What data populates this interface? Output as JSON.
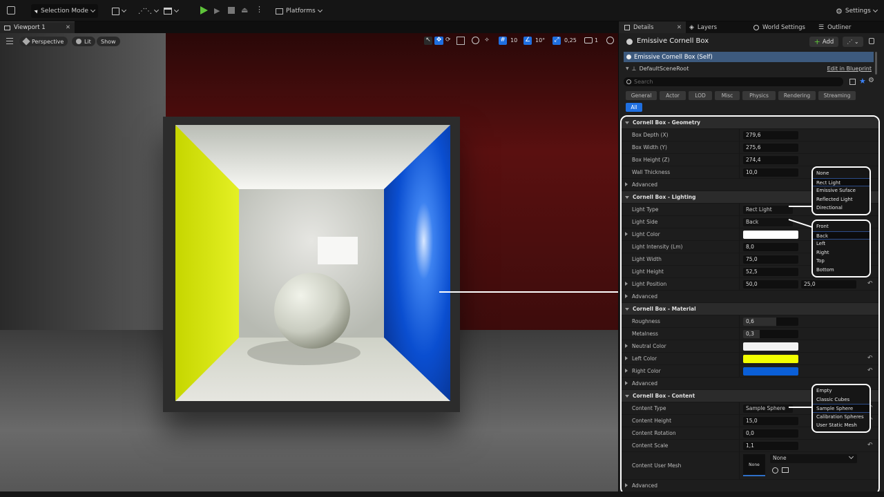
{
  "toolbar": {
    "mode_label": "Selection Mode",
    "platforms_label": "Platforms",
    "settings_label": "Settings"
  },
  "viewport": {
    "tab_label": "Viewport 1",
    "perspective_label": "Perspective",
    "lit_label": "Lit",
    "show_label": "Show",
    "grid_snap": "10",
    "rot_snap": "10°",
    "scale_snap": "0,25",
    "cam_speed": "1"
  },
  "details": {
    "tabs": {
      "details": "Details",
      "layers": "Layers",
      "world": "World Settings",
      "outliner": "Outliner"
    },
    "actor_name": "Emissive Cornell Box",
    "add_label": "Add",
    "self_item": "Emissive Cornell Box (Self)",
    "root_item": "DefaultSceneRoot",
    "edit_blueprint": "Edit in Blueprint",
    "search_placeholder": "Search",
    "filters": [
      "General",
      "Actor",
      "LOD",
      "Misc",
      "Physics",
      "Rendering",
      "Streaming",
      "All"
    ]
  },
  "props": {
    "geometry": {
      "title": "Cornell Box - Geometry",
      "depth_label": "Box Depth (X)",
      "depth": "279,6",
      "width_label": "Box Width (Y)",
      "width": "275,6",
      "height_label": "Box Height (Z)",
      "height": "274,4",
      "wall_label": "Wall Thickness",
      "wall": "10,0",
      "advanced": "Advanced"
    },
    "lighting": {
      "title": "Cornell Box - Lighting",
      "type_label": "Light Type",
      "type": "Rect Light",
      "side_label": "Light Side",
      "side": "Back",
      "color_label": "Light Color",
      "intensity_label": "Light Intensity (Lm)",
      "intensity": "8,0",
      "lwidth_label": "Light Width",
      "lwidth": "75,0",
      "lheight_label": "Light Height",
      "lheight": "52,5",
      "pos_label": "Light Position",
      "pos_x": "50,0",
      "pos_y": "25,0",
      "advanced": "Advanced"
    },
    "material": {
      "title": "Cornell Box - Material",
      "rough_label": "Roughness",
      "rough": "0,6",
      "metal_label": "Metalness",
      "metal": "0,3",
      "neutral_label": "Neutral Color",
      "left_label": "Left Color",
      "right_label": "Right Color",
      "advanced": "Advanced"
    },
    "content": {
      "title": "Cornell Box - Content",
      "type_label": "Content Type",
      "type": "Sample Sphere",
      "height_label": "Content Height",
      "height": "15,0",
      "rot_label": "Content Rotation",
      "rot": "0,0",
      "scale_label": "Content Scale",
      "scale": "1,1",
      "mesh_label": "Content User Mesh",
      "mesh_thumb": "None",
      "mesh_value": "None",
      "advanced": "Advanced"
    }
  },
  "dropdowns": {
    "light_type": [
      "None",
      "Rect Light",
      "Emissive Suface",
      "Reflected Light",
      "Directional"
    ],
    "light_side": [
      "Front",
      "Back",
      "Left",
      "Right",
      "Top",
      "Bottom"
    ],
    "content_type": [
      "Empty",
      "Classic Cubes",
      "Sample Sphere",
      "Calibration Spheres",
      "User Static Mesh"
    ]
  },
  "colors": {
    "light": "#ffffff",
    "neutral": "#f2f2f2",
    "left": "#f2ff00",
    "right": "#0a5fd8",
    "accent": "#1f6fe0"
  }
}
